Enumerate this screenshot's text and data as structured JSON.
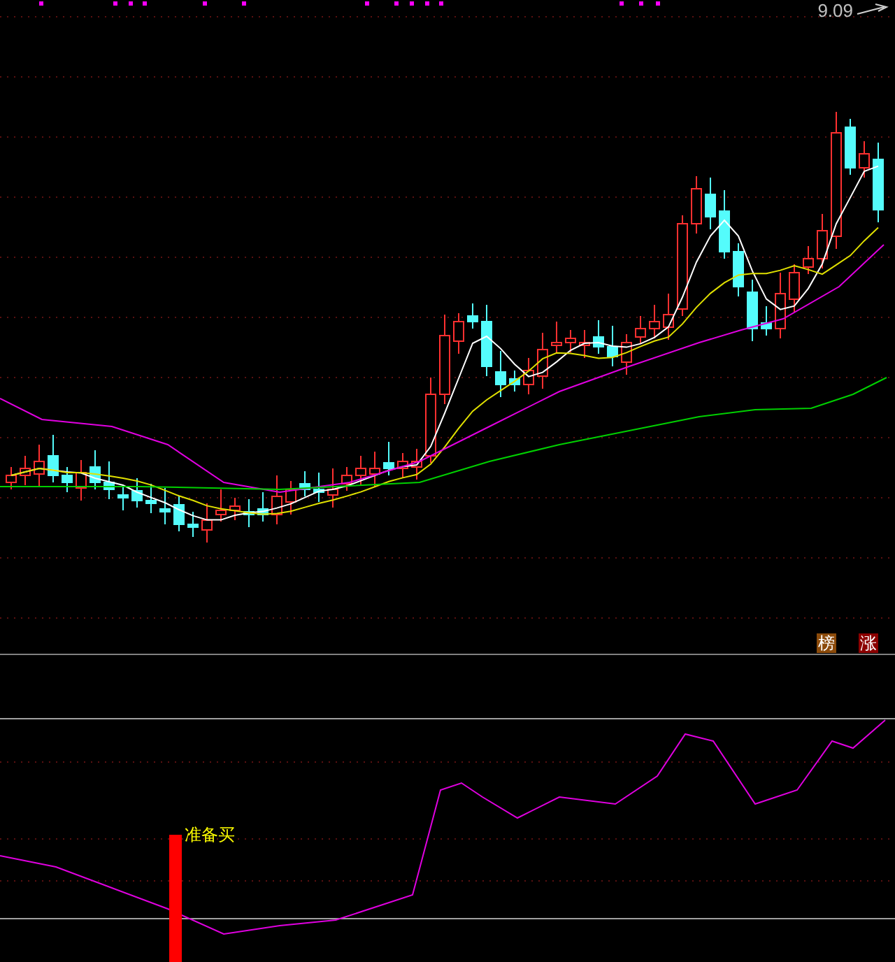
{
  "price_label": "9.09",
  "badges": [
    {
      "text": "榜",
      "color": "#8b4a0a"
    },
    {
      "text": "涨",
      "color": "#8b0000"
    }
  ],
  "signal_label": "准备买"
}
